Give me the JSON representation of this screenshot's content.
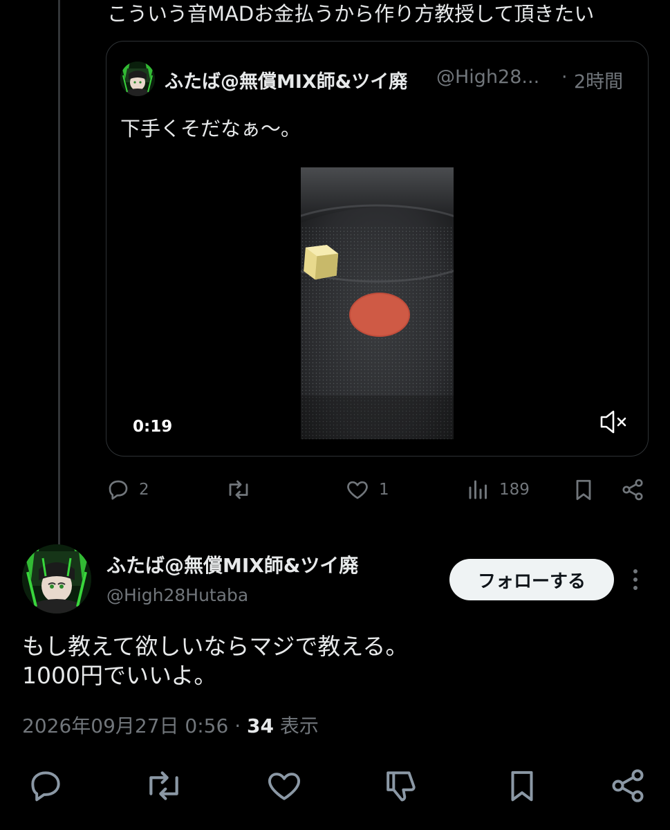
{
  "parent_tweet": {
    "text": "こういう音MADお金払うから作り方教授して頂きたい"
  },
  "quoted_tweet": {
    "author_name": "ふたば@無償MIX師&ツイ廃",
    "author_handle": "@High28...",
    "separator": "·",
    "time": "2時間",
    "text": "下手くそだなぁ〜。",
    "video": {
      "duration": "0:19",
      "mute_icon": "speaker-muted-icon"
    },
    "actions": {
      "reply_count": "2",
      "retweet_count": "",
      "like_count": "1",
      "view_count": "189"
    }
  },
  "reply_tweet": {
    "author_name": "ふたば@無償MIX師&ツイ廃",
    "author_handle": "@High28Hutaba",
    "follow_label": "フォローする",
    "text_line1": "もし教えて欲しいならマジで教える。",
    "text_line2": "1000円でいいよ。",
    "timestamp": "2026年09月27日 0:56",
    "meta_separator": " · ",
    "views_count": "34",
    "views_label": " 表示"
  },
  "icons": {
    "reply": "reply-icon",
    "retweet": "retweet-icon",
    "like": "heart-icon",
    "views": "views-icon",
    "bookmark": "bookmark-icon",
    "share": "share-icon",
    "dislike": "dislike-icon",
    "more": "more-vertical-icon"
  },
  "colors": {
    "background": "#000000",
    "text_primary": "#e7e9ea",
    "text_secondary": "#71767b",
    "border": "#2f3336",
    "follow_button_bg": "#eff3f4",
    "avatar_accent": "#39d63c"
  }
}
